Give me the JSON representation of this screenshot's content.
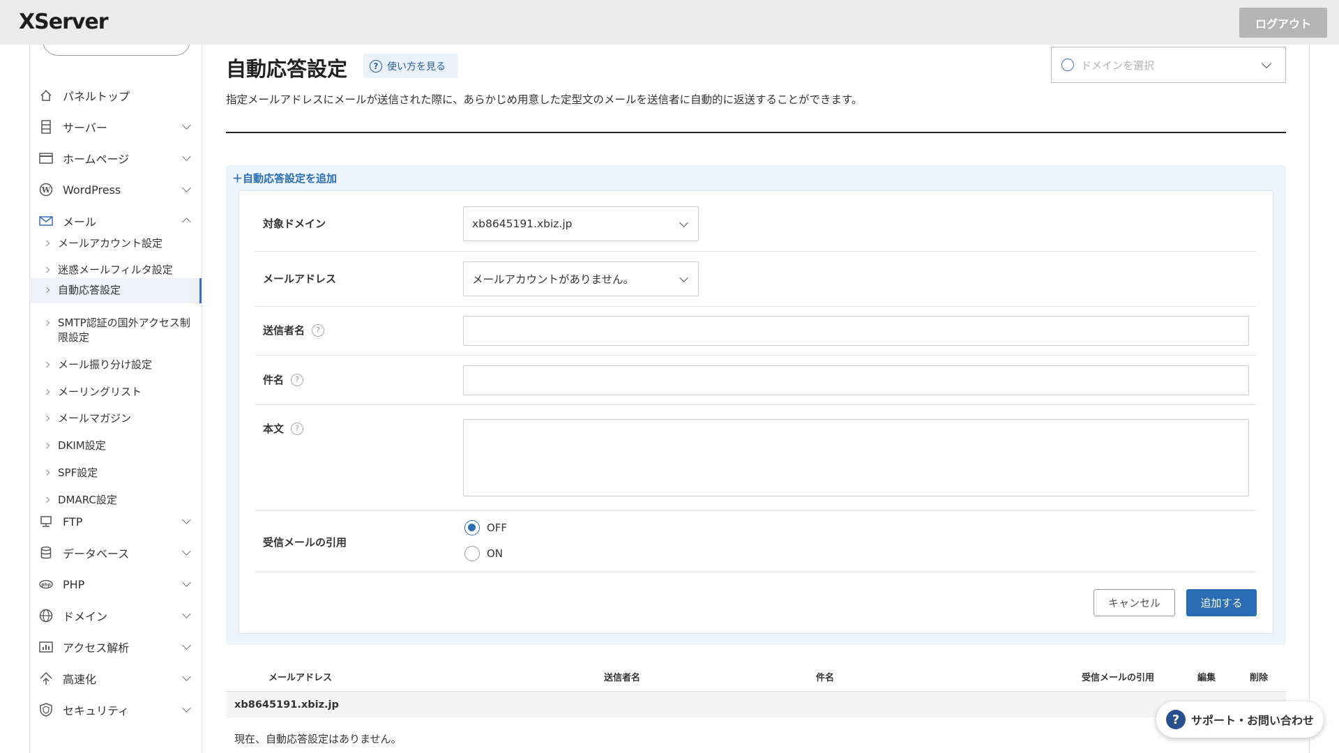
{
  "header": {
    "logo": "XServer",
    "logout_label": "ログアウト"
  },
  "sidebar": {
    "items": [
      {
        "label": "パネルトップ",
        "icon": "home-icon"
      },
      {
        "label": "サーバー",
        "icon": "server-icon"
      },
      {
        "label": "ホームページ",
        "icon": "browser-window-icon"
      },
      {
        "label": "WordPress",
        "icon": "wordpress-icon"
      },
      {
        "label": "メール",
        "icon": "envelope-icon"
      },
      {
        "label": "FTP",
        "icon": "ftp-icon"
      },
      {
        "label": "データベース",
        "icon": "database-icon"
      },
      {
        "label": "PHP",
        "icon": "php-icon"
      },
      {
        "label": "ドメイン",
        "icon": "globe-icon"
      },
      {
        "label": "アクセス解析",
        "icon": "bar-chart-icon"
      },
      {
        "label": "高速化",
        "icon": "speed-icon"
      },
      {
        "label": "セキュリティ",
        "icon": "shield-icon"
      }
    ],
    "mail_sub": [
      "メールアカウント設定",
      "迷惑メールフィルタ設定",
      "自動応答設定",
      "SMTP認証の国外アクセス制限設定",
      "メール振り分け設定",
      "メーリングリスト",
      "メールマガジン",
      "DKIM設定",
      "SPF設定",
      "DMARC設定"
    ],
    "active_sub": "自動応答設定"
  },
  "main": {
    "title": "自動応答設定",
    "howto_label": "使い方を見る",
    "domain_select_placeholder": "ドメインを選択",
    "description": "指定メールアドレスにメールが送信された際に、あらかじめ用意した定型文のメールを送信者に自動的に返送することができます。"
  },
  "form": {
    "add_link": "自動応答設定を追加",
    "domain_label": "対象ドメイン",
    "domain_value": "xb8645191.xbiz.jp",
    "address_label": "メールアドレス",
    "address_value": "メールアカウントがありません。",
    "sender_label": "送信者名",
    "subject_label": "件名",
    "body_label": "本文",
    "quote_label": "受信メールの引用",
    "quote_options": [
      "OFF",
      "ON"
    ],
    "quote_selected": "OFF",
    "cancel_label": "キャンセル",
    "submit_label": "追加する"
  },
  "table": {
    "headers": [
      "メールアドレス",
      "送信者名",
      "件名",
      "受信メールの引用",
      "編集",
      "削除"
    ],
    "group": "xb8645191.xbiz.jp",
    "empty_message": "現在、自動応答設定はありません。"
  },
  "support": {
    "label": "サポート・お問い合わせ"
  },
  "colors": {
    "accent": "#2a6db5",
    "panel_bg": "#edf3fa",
    "header_bg": "#ebebeb"
  }
}
